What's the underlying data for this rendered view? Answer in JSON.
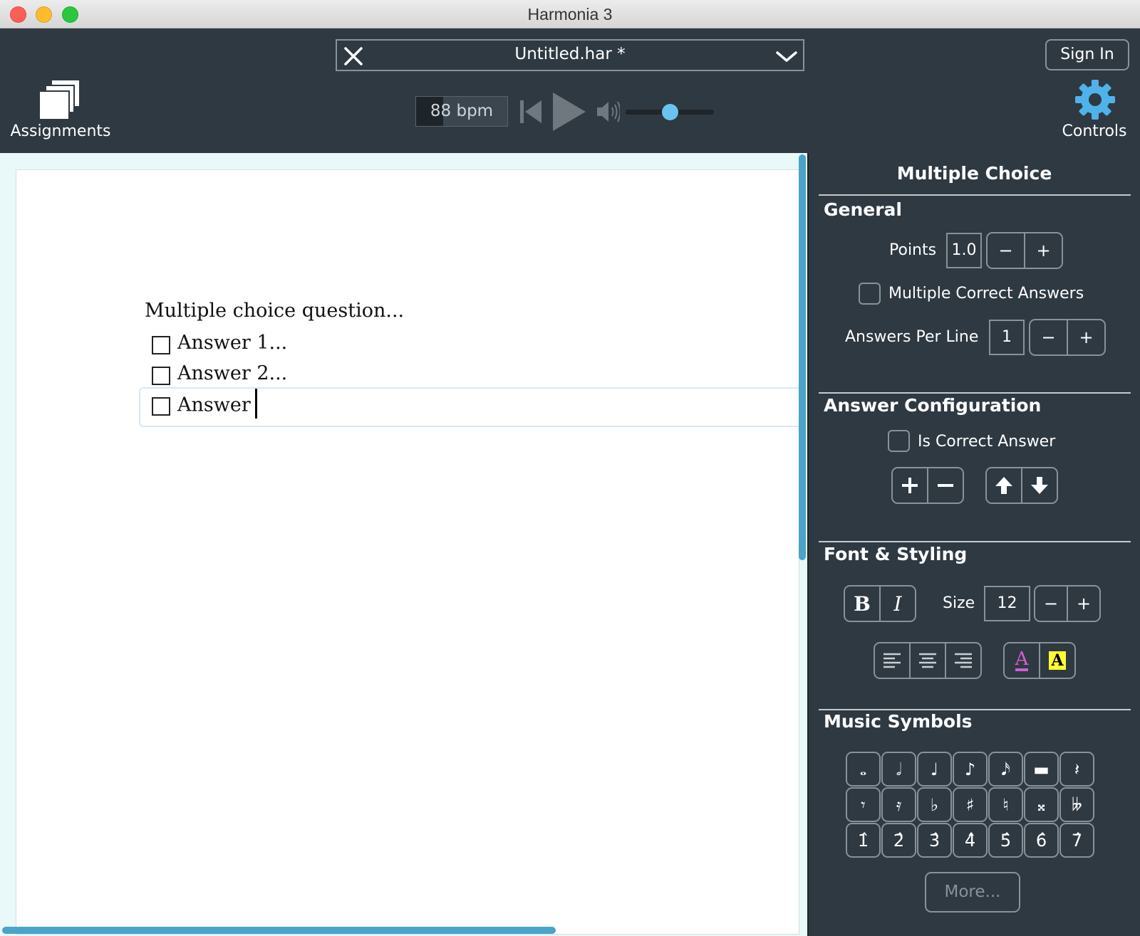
{
  "window": {
    "title": "Harmonia 3"
  },
  "toolbar": {
    "file_name": "Untitled.har *",
    "sign_in": "Sign In",
    "assignments": "Assignments",
    "controls": "Controls",
    "tempo": "88 bpm",
    "volume_level": 0.5
  },
  "document": {
    "question": "Multiple choice question...",
    "answers": [
      "Answer 1...",
      "Answer 2...",
      "Answer"
    ]
  },
  "panel": {
    "title": "Multiple Choice",
    "general": {
      "heading": "General",
      "points_label": "Points",
      "points_value": "1.0",
      "multiple_correct_label": "Multiple Correct Answers",
      "answers_per_line_label": "Answers Per Line",
      "answers_per_line_value": "1"
    },
    "answer_config": {
      "heading": "Answer Configuration",
      "is_correct_label": "Is Correct Answer"
    },
    "font_styling": {
      "heading": "Font & Styling",
      "bold": "B",
      "italic": "I",
      "size_label": "Size",
      "size_value": "12",
      "text_color_glyph": "A",
      "highlight_glyph": "A"
    },
    "music_symbols": {
      "heading": "Music Symbols",
      "symbols": [
        "𝅝",
        "𝅗𝅥",
        "♩",
        "♪",
        "𝅘𝅥𝅯",
        "▬",
        "𝄽",
        "𝄾",
        "𝄿",
        "♭",
        "♯",
        "♮",
        "𝄪",
        "𝄫",
        "1̂",
        "2̂",
        "3̂",
        "4̂",
        "5̂",
        "6̂",
        "7̂"
      ],
      "more": "More..."
    }
  },
  "colors": {
    "accent": "#4aa4c9",
    "thumb": "#6ac2ef",
    "gear": "#4fb2ea",
    "highlight": "#ffff33",
    "text_color": "#d05fd2"
  }
}
